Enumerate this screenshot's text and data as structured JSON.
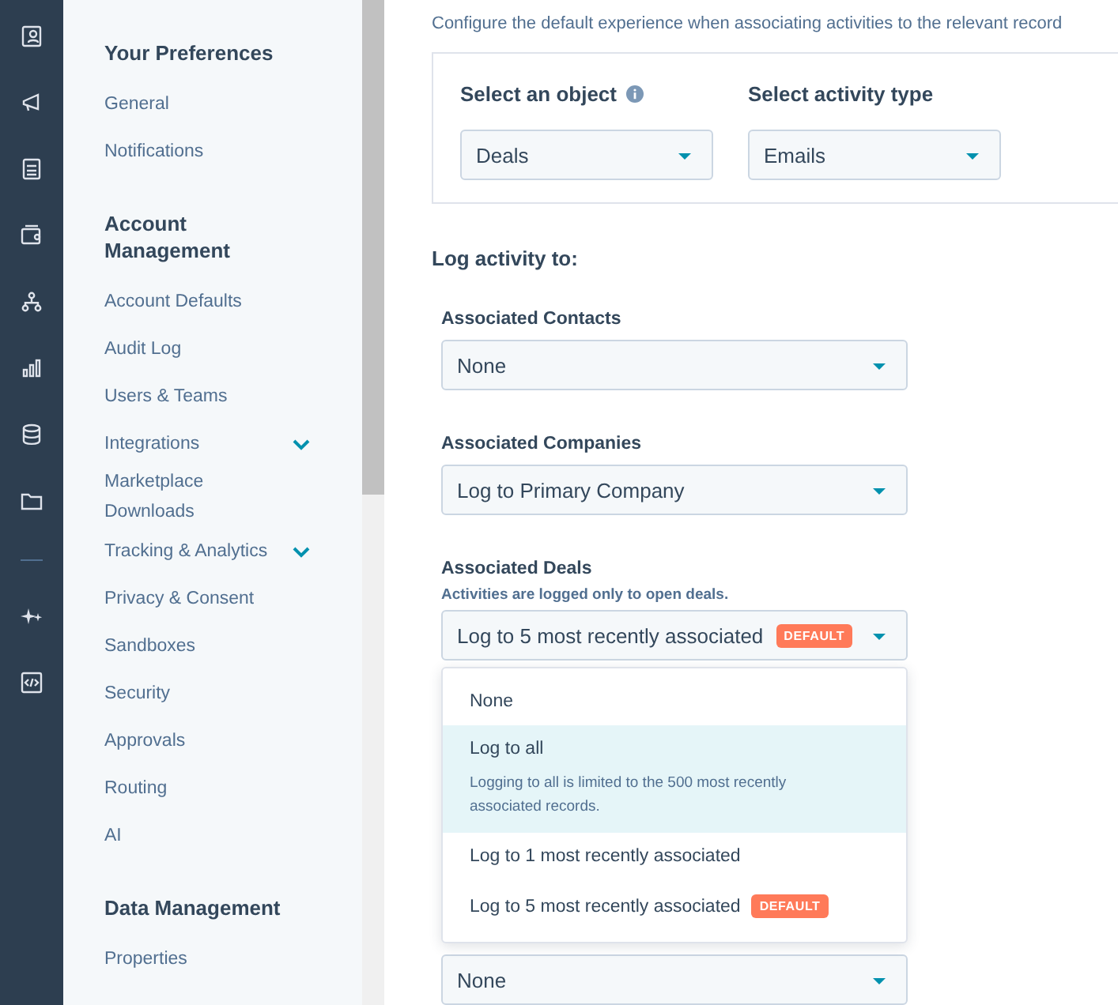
{
  "rail": {
    "icons": [
      {
        "kind": "contacts"
      },
      {
        "kind": "megaphone"
      },
      {
        "kind": "document"
      },
      {
        "kind": "wallet"
      },
      {
        "kind": "hierarchy"
      },
      {
        "kind": "chart"
      },
      {
        "kind": "database"
      },
      {
        "kind": "folder"
      },
      {
        "kind": "divider"
      },
      {
        "kind": "sparkle"
      },
      {
        "kind": "code"
      }
    ]
  },
  "sidebar": {
    "sections": [
      {
        "heading": "Your Preferences",
        "items": [
          {
            "label": "General",
            "expandable": false
          },
          {
            "label": "Notifications",
            "expandable": false
          }
        ]
      },
      {
        "heading": "Account Management",
        "items": [
          {
            "label": "Account Defaults",
            "expandable": false
          },
          {
            "label": "Audit Log",
            "expandable": false
          },
          {
            "label": "Users & Teams",
            "expandable": false
          },
          {
            "label": "Integrations",
            "expandable": true
          },
          {
            "label": "Marketplace Downloads",
            "expandable": false
          },
          {
            "label": "Tracking & Analytics",
            "expandable": true
          },
          {
            "label": "Privacy & Consent",
            "expandable": false
          },
          {
            "label": "Sandboxes",
            "expandable": false
          },
          {
            "label": "Security",
            "expandable": false
          },
          {
            "label": "Approvals",
            "expandable": false
          },
          {
            "label": "Routing",
            "expandable": false
          },
          {
            "label": "AI",
            "expandable": false
          }
        ]
      },
      {
        "heading": "Data Management",
        "items": [
          {
            "label": "Properties",
            "expandable": false
          }
        ]
      }
    ]
  },
  "intro": "Configure the default experience when associating activities to the relevant record",
  "selectors": [
    {
      "label": "Select an object",
      "info": true,
      "value": "Deals"
    },
    {
      "label": "Select activity type",
      "value": "Emails"
    }
  ],
  "log_heading": "Log activity to:",
  "fields": [
    {
      "label": "Associated Contacts",
      "value": "None"
    },
    {
      "label": "Associated Companies",
      "value": "Log to Primary Company"
    },
    {
      "label": "Associated Deals",
      "hint": "Activities are logged only to open deals.",
      "value": "Log to 5 most recently associated",
      "badge": "DEFAULT",
      "open": true
    },
    {
      "value": "None"
    }
  ],
  "dropdown": {
    "options": [
      {
        "label": "None",
        "selected": false
      },
      {
        "label": "Log to all",
        "description": "Logging to all is limited to the 500 most recently associated records.",
        "selected": true
      },
      {
        "label": "Log to 1 most recently associated",
        "selected": false
      },
      {
        "label": "Log to 5 most recently associated",
        "badge": "DEFAULT",
        "selected": false
      }
    ]
  }
}
